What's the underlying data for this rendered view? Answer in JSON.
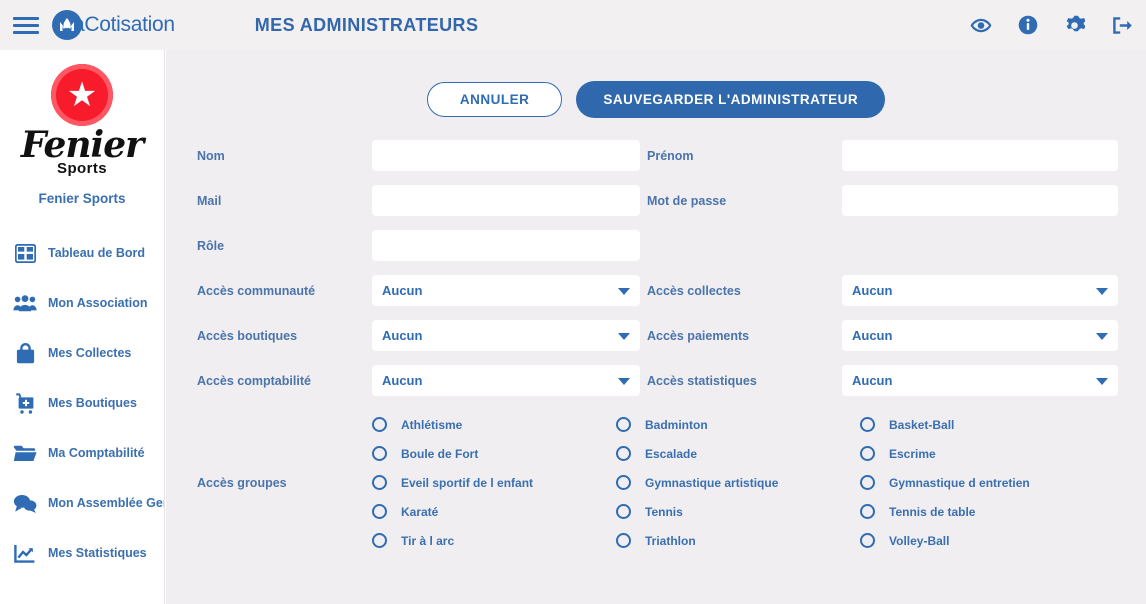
{
  "topbar": {
    "menu_icon": "hamburger-icon",
    "brand_name": "aCotisation",
    "brand_mark": "macotisation-logo",
    "page_title": "MES ADMINISTRATEURS",
    "icons": [
      {
        "name": "eye-icon",
        "label": "Aperçu"
      },
      {
        "name": "info-icon",
        "label": "Informations"
      },
      {
        "name": "gear-icon",
        "label": "Paramètres"
      },
      {
        "name": "logout-icon",
        "label": "Déconnexion"
      }
    ]
  },
  "sidebar": {
    "logo": {
      "badge": "star-badge",
      "script_text": "Fenier",
      "sub_text": "Sports"
    },
    "org_name": "Fenier Sports",
    "items": [
      {
        "label": "Tableau de Bord",
        "icon": "dashboard-icon"
      },
      {
        "label": "Mon Association",
        "icon": "people-icon"
      },
      {
        "label": "Mes Collectes",
        "icon": "bag-icon"
      },
      {
        "label": "Mes Boutiques",
        "icon": "cart-icon"
      },
      {
        "label": "Ma Comptabilité",
        "icon": "folder-icon"
      },
      {
        "label": "Mon Assemblée Gen.",
        "icon": "chat-icon"
      },
      {
        "label": "Mes Statistiques",
        "icon": "chart-icon"
      }
    ]
  },
  "main": {
    "actions": {
      "cancel_label": "ANNULER",
      "save_label": "SAUVEGARDER L'ADMINISTRATEUR"
    },
    "fields": {
      "nom": {
        "label": "Nom",
        "value": "",
        "placeholder": ""
      },
      "prenom": {
        "label": "Prénom",
        "value": "",
        "placeholder": ""
      },
      "mail": {
        "label": "Mail",
        "value": "",
        "placeholder": ""
      },
      "mot_de_passe": {
        "label": "Mot de passe",
        "value": "",
        "placeholder": ""
      },
      "role": {
        "label": "Rôle",
        "value": "",
        "placeholder": ""
      }
    },
    "selects": {
      "acces_communaute": {
        "label": "Accès communauté",
        "value": "Aucun"
      },
      "acces_collectes": {
        "label": "Accès collectes",
        "value": "Aucun"
      },
      "acces_boutiques": {
        "label": "Accès boutiques",
        "value": "Aucun"
      },
      "acces_paiements": {
        "label": "Accès paiements",
        "value": "Aucun"
      },
      "acces_comptabilite": {
        "label": "Accès comptabilité",
        "value": "Aucun"
      },
      "acces_statistiques": {
        "label": "Accès statistiques",
        "value": "Aucun"
      }
    },
    "groups": {
      "label": "Accès groupes",
      "columns": [
        [
          "Athlétisme",
          "Boule de Fort",
          "Eveil sportif de l enfant",
          "Karaté",
          "Tir à l arc"
        ],
        [
          "Badminton",
          "Escalade",
          "Gymnastique artistique",
          "Tennis",
          "Triathlon"
        ],
        [
          "Basket-Ball",
          "Escrime",
          "Gymnastique d entretien",
          "Tennis de table",
          "Volley-Ball"
        ]
      ]
    }
  },
  "colors": {
    "primary_blue": "#2f6cb4",
    "save_button_blue": "#2f68ad",
    "label_blue": "#4a74ab",
    "topbar_bg": "#f2f0f1",
    "main_bg": "#f0eef0",
    "sidebar_bg": "#ffffff",
    "badge_red": "#f71b2b"
  }
}
